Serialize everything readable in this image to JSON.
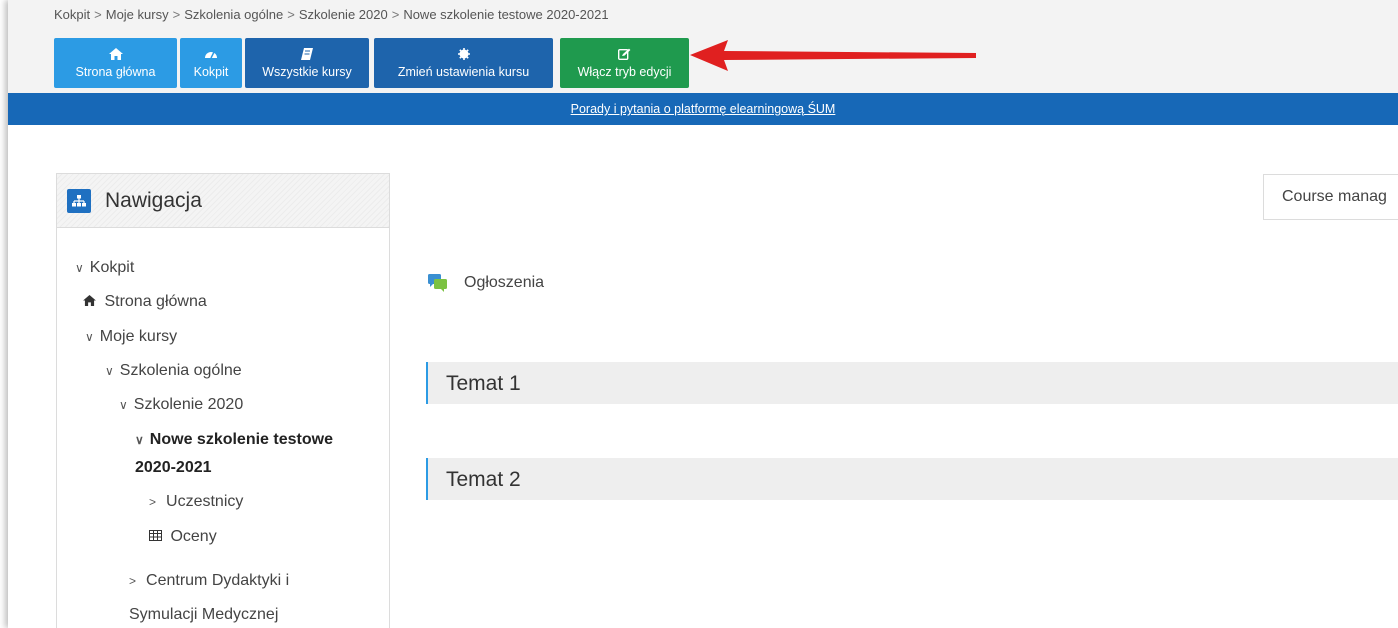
{
  "breadcrumb": [
    "Kokpit",
    "Moje kursy",
    "Szkolenia ogólne",
    "Szkolenie 2020",
    "Nowe szkolenie testowe 2020-2021"
  ],
  "toolbar": {
    "home": "Strona główna",
    "dashboard": "Kokpit",
    "all_courses": "Wszystkie kursy",
    "course_settings": "Zmień ustawienia kursu",
    "edit_mode": "Włącz tryb edycji"
  },
  "banner_link": "Porady i pytania o platformę elearningową ŚUM",
  "navigation": {
    "title": "Nawigacja",
    "items": [
      "Kokpit",
      "Strona główna",
      "Moje kursy",
      "Szkolenia ogólne",
      "Szkolenie 2020",
      "Nowe szkolenie testowe",
      "2020-2021",
      "Uczestnicy",
      "Oceny",
      "Centrum Dydaktyki i",
      "Symulacji Medycznej"
    ]
  },
  "course_management": "Course manag",
  "announcements": "Ogłoszenia",
  "sections": [
    "Temat 1",
    "Temat 2"
  ],
  "colors": {
    "accent_blue": "#2c9be4",
    "navy": "#1e64ac",
    "green": "#1f9a4e",
    "banner": "#1768b7",
    "arrow": "#e02020"
  }
}
